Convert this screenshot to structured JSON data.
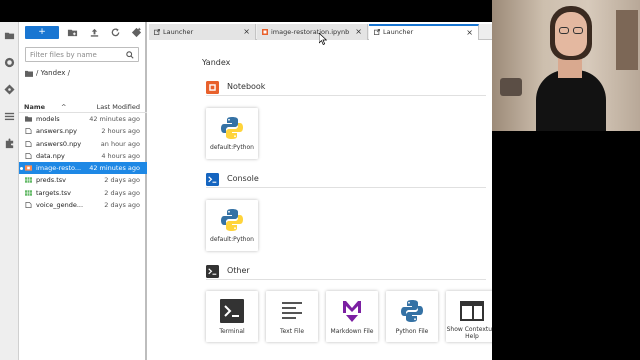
{
  "toolbar": {
    "new_label": "+",
    "filter_placeholder": "Filter files by name"
  },
  "breadcrumb": {
    "path": "/ Yandex /"
  },
  "file_list": {
    "header_name": "Name",
    "header_sort": "^",
    "header_modified": "Last Modified",
    "rows": [
      {
        "name": "models",
        "modified": "42 minutes ago",
        "icon": "folder-icon",
        "selected": false
      },
      {
        "name": "answers.npy",
        "modified": "2 hours ago",
        "icon": "file-icon",
        "selected": false
      },
      {
        "name": "answers0.npy",
        "modified": "an hour ago",
        "icon": "file-icon",
        "selected": false
      },
      {
        "name": "data.npy",
        "modified": "4 hours ago",
        "icon": "file-icon",
        "selected": false
      },
      {
        "name": "image-resto...",
        "modified": "42 minutes ago",
        "icon": "notebook-icon",
        "selected": true
      },
      {
        "name": "preds.tsv",
        "modified": "2 days ago",
        "icon": "spreadsheet-icon",
        "selected": false
      },
      {
        "name": "targets.tsv",
        "modified": "2 days ago",
        "icon": "spreadsheet-icon",
        "selected": false
      },
      {
        "name": "voice_gende...",
        "modified": "2 days ago",
        "icon": "file-icon",
        "selected": false
      }
    ]
  },
  "tabs": [
    {
      "label": "Launcher",
      "close": "×",
      "active": false
    },
    {
      "label": "image-restoration.ipynb",
      "close": "×",
      "active": false
    },
    {
      "label": "Launcher",
      "close": "×",
      "active": true
    }
  ],
  "launcher": {
    "title": "Yandex",
    "sections": {
      "notebook": {
        "label": "Notebook",
        "card": "default:Python"
      },
      "console": {
        "label": "Console",
        "card": "default:Python"
      },
      "other": {
        "label": "Other",
        "cards": [
          "Terminal",
          "Text File",
          "Markdown File",
          "Python File",
          "Show Contextual Help"
        ]
      }
    }
  },
  "colors": {
    "accent": "#1976d2",
    "notebook_orange": "#e8612c",
    "console_blue": "#1565c0",
    "other_dark": "#333333",
    "markdown_purple": "#7b1fa2",
    "python_blue": "#3572a5",
    "python_yellow": "#ffd43b"
  }
}
